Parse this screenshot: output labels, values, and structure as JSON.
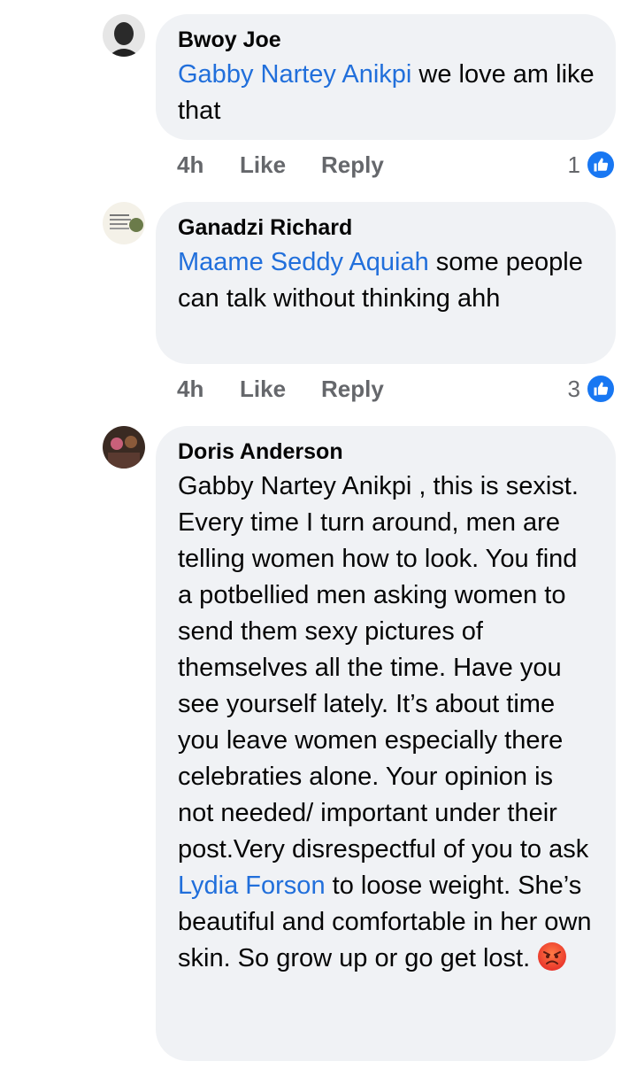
{
  "comments": [
    {
      "author": "Bwoy Joe",
      "mention": "Gabby Nartey Anikpi",
      "text_after": " we love am like that",
      "time": "4h",
      "like": "Like",
      "reply": "Reply",
      "reaction_count": "1",
      "reaction_icon": "thumbs-up-icon"
    },
    {
      "author": "Ganadzi Richard",
      "mention": "Maame Seddy Aquiah",
      "text_after": " some people can talk without thinking ahh",
      "time": "4h",
      "like": "Like",
      "reply": "Reply",
      "reaction_count": "3",
      "reaction_icon": "thumbs-up-icon"
    },
    {
      "author": "Doris Anderson",
      "text_before": "Gabby Nartey Anikpi , this is sexist. Every time I turn around, men are telling women how to look. You find a potbellied men asking women to send them sexy pictures of themselves all the time. Have you see yourself lately. It’s about time you leave women especially there celebraties alone. Your opinion is not needed/ important under their post.Very disrespectful of you to ask ",
      "mention": "Lydia Forson",
      "text_after": " to loose weight. She’s beautiful and comfortable in her own skin. So grow up or go get lost. ",
      "emoji": "angry-face-emoji"
    }
  ],
  "colors": {
    "bubble": "#f0f2f5",
    "mention": "#216fdb",
    "meta": "#65676b",
    "like_blue": "#1877f2"
  }
}
